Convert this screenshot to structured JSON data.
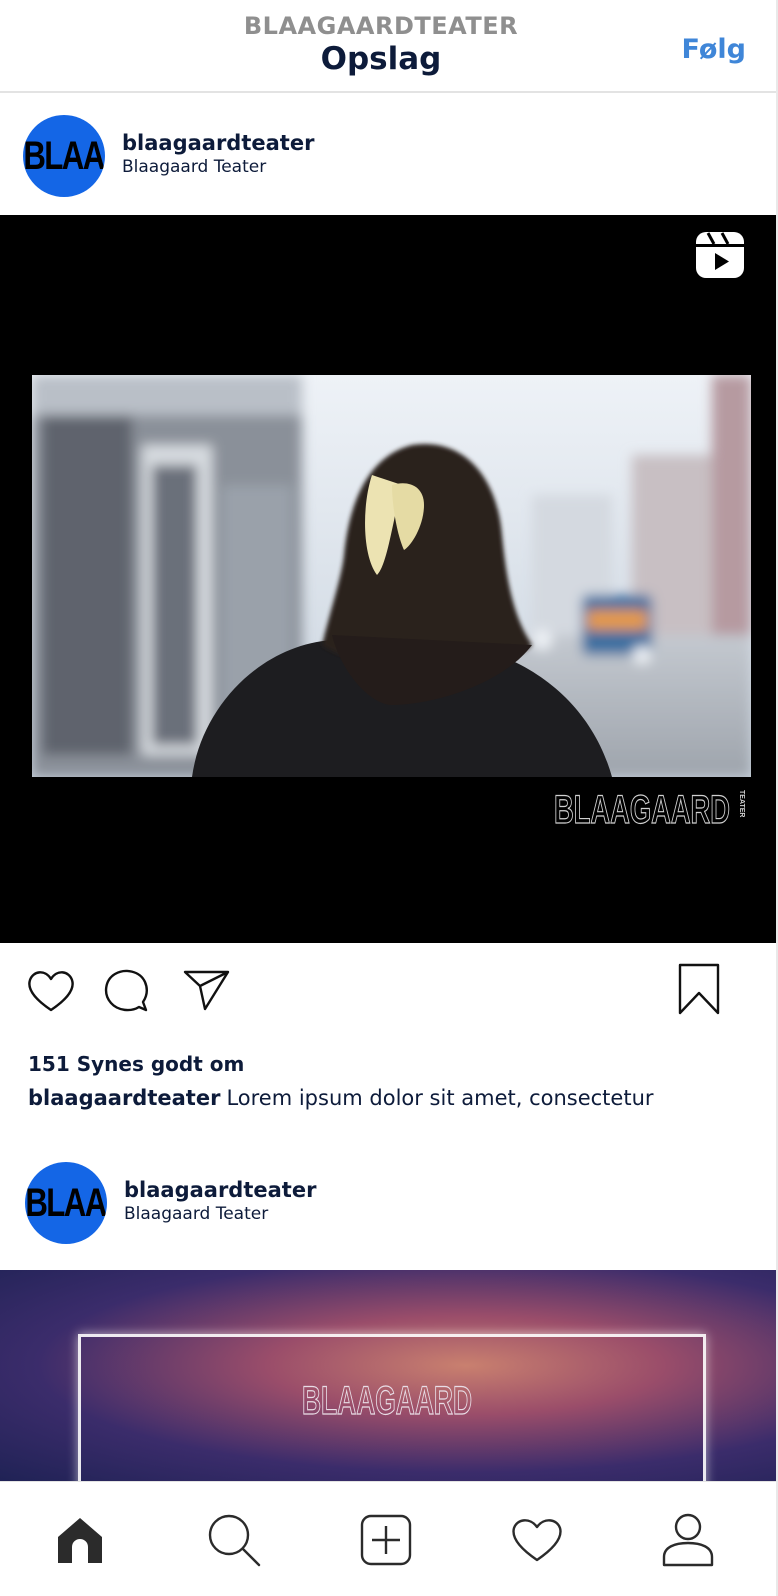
{
  "header": {
    "account_label": "BLAAGAARDTEATER",
    "title": "Opslag",
    "follow_label": "Følg"
  },
  "posts": [
    {
      "avatar_text": "BLAA",
      "username": "blaagaardteater",
      "display_name": "Blaagaard Teater",
      "media_type_icon": "reels-icon",
      "watermark_text": "BLAAGAARD",
      "watermark_small": "TEATER",
      "likes_text": "151 Synes godt om",
      "caption_user": "blaagaardteater",
      "caption_text": "Lorem ipsum dolor sit amet, consectetur"
    },
    {
      "avatar_text": "BLAA",
      "username": "blaagaardteater",
      "display_name": "Blaagaard Teater",
      "overlay_text": "BLAAGAARD"
    }
  ],
  "actions": {
    "like_icon": "heart-icon",
    "comment_icon": "comment-icon",
    "share_icon": "send-icon",
    "save_icon": "bookmark-icon"
  },
  "bottom_nav": {
    "items": [
      "home-icon",
      "search-icon",
      "add-post-icon",
      "activity-heart-icon",
      "profile-icon"
    ]
  },
  "colors": {
    "brand_blue": "#1466e6",
    "follow_blue": "#3f86d8",
    "text_navy": "#0d1b3a",
    "subtitle_gray": "#8f8f8f"
  }
}
